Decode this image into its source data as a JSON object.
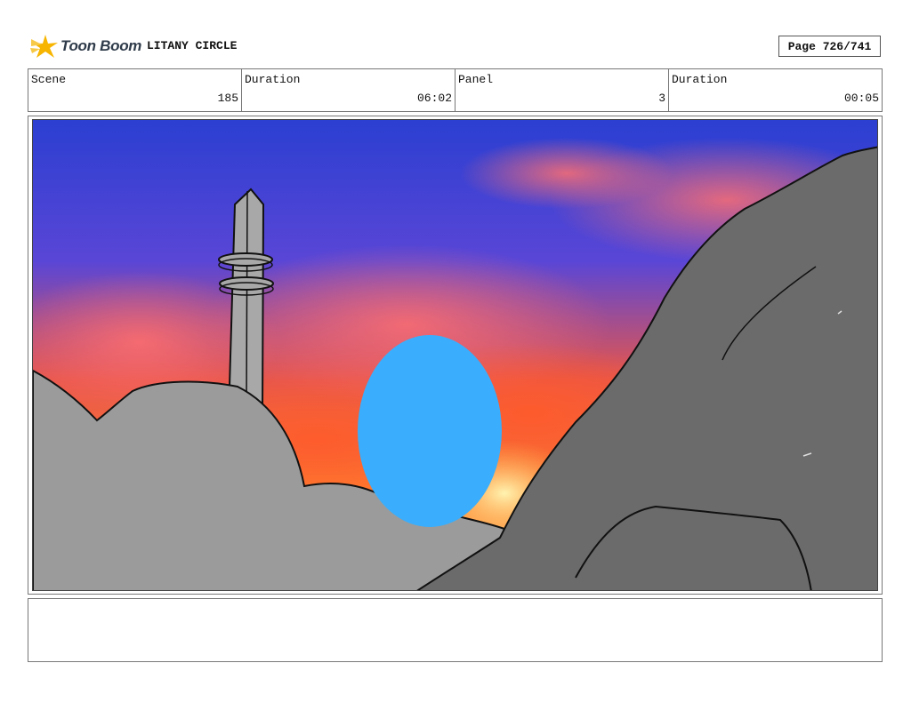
{
  "header": {
    "brand": "Toon Boom",
    "project_title": "LITANY CIRCLE",
    "page_indicator": "Page 726/741"
  },
  "info": {
    "scene_label": "Scene",
    "scene_value": "185",
    "scene_duration_label": "Duration",
    "scene_duration_value": "06:02",
    "panel_label": "Panel",
    "panel_value": "3",
    "panel_duration_label": "Duration",
    "panel_duration_value": "00:05"
  },
  "panel": {
    "sky_colors": [
      "#2b3fd1",
      "#6a4fd8",
      "#ff6a3a",
      "#ffb347"
    ],
    "foreground_gray": "#9b9b9b",
    "rock_gray": "#6b6b6b",
    "orb_color": "#3aaefc"
  },
  "notes": {
    "text": ""
  }
}
